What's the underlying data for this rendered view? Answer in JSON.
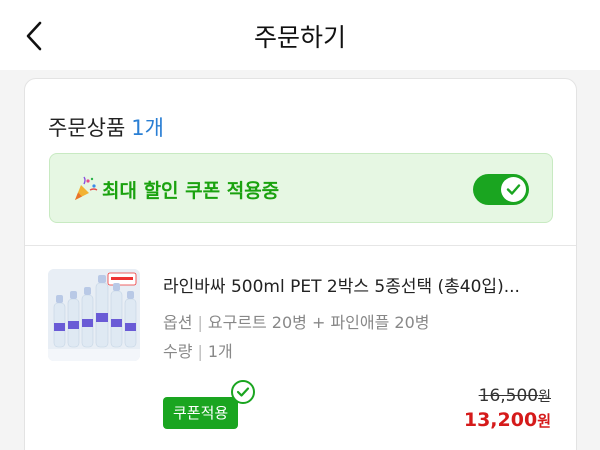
{
  "header": {
    "title": "주문하기",
    "back_icon": "chevron-left-icon"
  },
  "order": {
    "section_label": "주문상품",
    "item_count": "1개",
    "coupon_banner": {
      "icon": "party-popper-icon",
      "text": "최대 할인 쿠폰 적용중",
      "toggle_on": true,
      "accent_color": "#1aa520"
    }
  },
  "product": {
    "name": "라인바싸 500ml PET 2박스 5종선택 (총40입)...",
    "option_label": "옵션",
    "option_value": "요구르트 20병 + 파인애플 20병",
    "qty_label": "수량",
    "qty_value": "1개",
    "coupon_badge": "쿠폰적용",
    "original_price": "16,500",
    "sale_price": "13,200",
    "currency": "원",
    "sale_color": "#d51a1a"
  }
}
